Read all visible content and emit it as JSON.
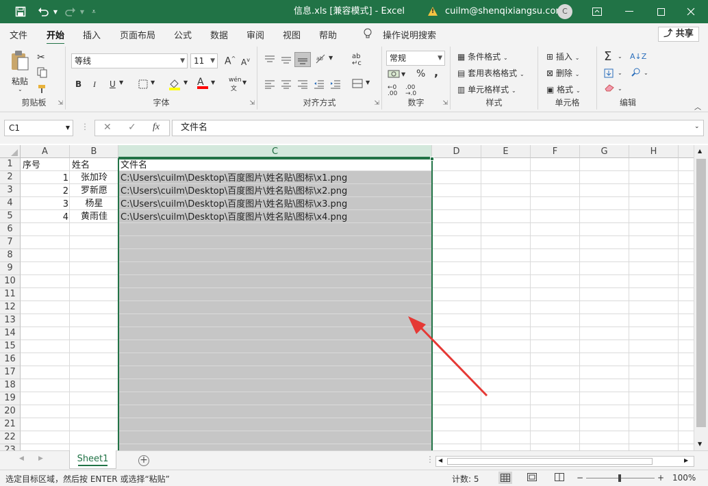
{
  "window": {
    "title": "信息.xls  [兼容模式]  -  Excel",
    "warning_icon": "warning-icon",
    "account": "cuilm@shenqixiangsu.com",
    "avatar_letter": "C",
    "accent_color": "#217346"
  },
  "ribbon_tabs": [
    "文件",
    "开始",
    "插入",
    "页面布局",
    "公式",
    "数据",
    "审阅",
    "视图",
    "帮助"
  ],
  "active_tab": "开始",
  "tell_me": "操作说明搜索",
  "share_label": "共享",
  "ribbon": {
    "clipboard": {
      "label": "剪贴板",
      "paste": "粘贴"
    },
    "font": {
      "label": "字体",
      "name": "等线",
      "size": "11",
      "bold": "B",
      "italic": "I",
      "underline": "U",
      "grow": "A",
      "shrink": "A",
      "fill_color": "#ffff00",
      "font_color": "#ff0000",
      "phonetic": "wén"
    },
    "alignment": {
      "label": "对齐方式"
    },
    "number": {
      "label": "数字",
      "format": "常规",
      "percent": "%",
      "comma": ","
    },
    "styles": {
      "label": "样式",
      "conditional": "条件格式",
      "table": "套用表格格式",
      "cell_styles": "单元格样式"
    },
    "cells": {
      "label": "单元格",
      "insert": "插入",
      "delete": "删除",
      "format": "格式"
    },
    "editing": {
      "label": "编辑"
    }
  },
  "formula_bar": {
    "name_box": "C1",
    "content": "文件名",
    "fx": "fx"
  },
  "columns": [
    "A",
    "B",
    "C",
    "D",
    "E",
    "F",
    "G",
    "H"
  ],
  "selected_column": "C",
  "rows": [
    "1",
    "2",
    "3",
    "4",
    "5",
    "6",
    "7",
    "8",
    "9",
    "10",
    "11",
    "12",
    "13",
    "14",
    "15",
    "16",
    "17",
    "18",
    "19",
    "20",
    "21",
    "22",
    "23"
  ],
  "cells": {
    "header": {
      "A": "序号",
      "B": "姓名",
      "C": "文件名"
    },
    "data": [
      {
        "A": "1",
        "B": "张加玲",
        "C": "C:\\Users\\cuilm\\Desktop\\百度图片\\姓名贴\\图标\\x1.png"
      },
      {
        "A": "2",
        "B": "罗新愿",
        "C": "C:\\Users\\cuilm\\Desktop\\百度图片\\姓名贴\\图标\\x2.png"
      },
      {
        "A": "3",
        "B": "杨星",
        "C": "C:\\Users\\cuilm\\Desktop\\百度图片\\姓名贴\\图标\\x3.png"
      },
      {
        "A": "4",
        "B": "黄雨佳",
        "C": "C:\\Users\\cuilm\\Desktop\\百度图片\\姓名贴\\图标\\x4.png"
      }
    ]
  },
  "sheet_tabs": [
    "Sheet1"
  ],
  "status": {
    "message": "选定目标区域，然后按 ENTER 或选择“粘贴”",
    "count": "计数: 5",
    "zoom": "100%",
    "zoom_minus": "−",
    "zoom_plus": "+"
  }
}
